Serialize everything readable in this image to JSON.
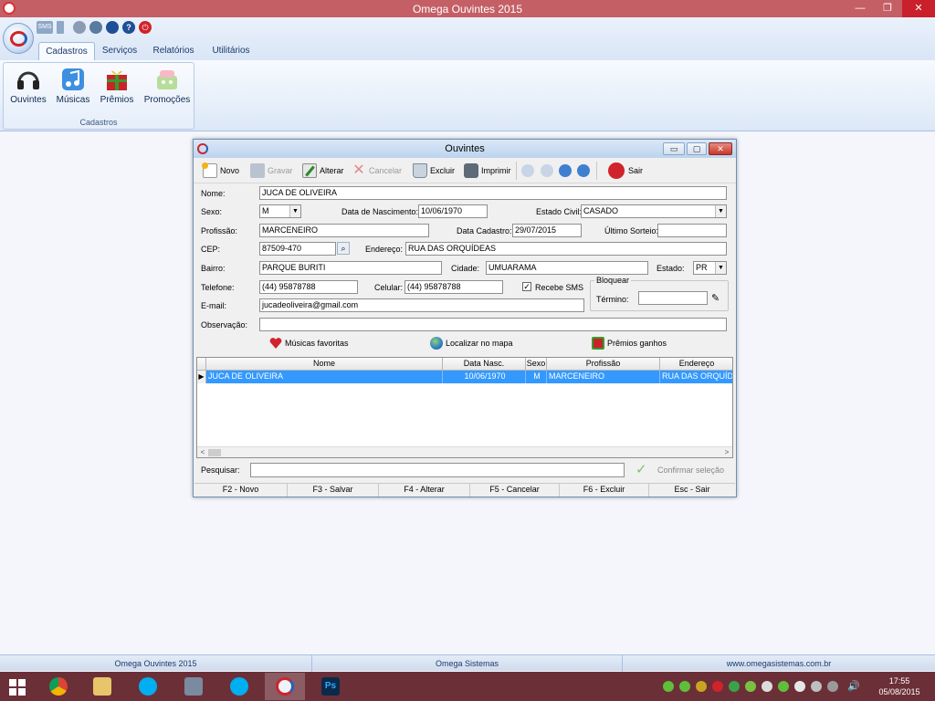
{
  "app": {
    "title": "Omega Ouvintes 2015",
    "window_controls": {
      "minimize": "—",
      "maximize": "❐",
      "close": "✕"
    }
  },
  "ribbon": {
    "tabs": [
      {
        "label": "Cadastros",
        "active": true
      },
      {
        "label": "Serviços",
        "active": false
      },
      {
        "label": "Relatórios",
        "active": false
      },
      {
        "label": "Utilitários",
        "active": false
      }
    ],
    "group_label": "Cadastros",
    "buttons": [
      {
        "label": "Ouvintes",
        "icon": "headphones-icon"
      },
      {
        "label": "Músicas",
        "icon": "music-note-icon"
      },
      {
        "label": "Prêmios",
        "icon": "gift-icon"
      },
      {
        "label": "Promoções",
        "icon": "promotion-icon"
      }
    ],
    "quick_access": {
      "sms": "SMS",
      "help": "?",
      "power": "⏻"
    }
  },
  "dialog": {
    "title": "Ouvintes",
    "controls": {
      "minimize": "▭",
      "maximize": "▢",
      "close": "✕"
    },
    "toolbar": {
      "novo": "Novo",
      "gravar": "Gravar",
      "alterar": "Alterar",
      "cancelar": "Cancelar",
      "excluir": "Excluir",
      "imprimir": "Imprimir",
      "sair": "Sair"
    },
    "form": {
      "nome_label": "Nome:",
      "nome": "JUCA DE OLIVEIRA",
      "sexo_label": "Sexo:",
      "sexo": "M",
      "nascimento_label": "Data de Nascimento:",
      "nascimento": "10/06/1970",
      "estado_civil_label": "Estado Civil:",
      "estado_civil": "CASADO",
      "profissao_label": "Profissão:",
      "profissao": "MARCENEIRO",
      "data_cadastro_label": "Data Cadastro:",
      "data_cadastro": "29/07/2015",
      "ultimo_sorteio_label": "Último Sorteio:",
      "ultimo_sorteio": "",
      "cep_label": "CEP:",
      "cep": "87509-470",
      "endereco_label": "Endereço:",
      "endereco": "RUA DAS ORQUÍDEAS",
      "bairro_label": "Bairro:",
      "bairro": "PARQUE BURITI",
      "cidade_label": "Cidade:",
      "cidade": "UMUARAMA",
      "estado_label": "Estado:",
      "estado": "PR",
      "telefone_label": "Telefone:",
      "telefone": "(44) 95878788",
      "celular_label": "Celular:",
      "celular": "(44) 95878788",
      "recebe_sms_label": "Recebe SMS",
      "recebe_sms_check": "✓",
      "bloquear_label": "Bloquear",
      "termino_label": "Término:",
      "termino": "",
      "email_label": "E-mail:",
      "email": "jucadeoliveira@gmail.com",
      "observacao_label": "Observação:",
      "observacao": ""
    },
    "links": {
      "musicas_favoritas": "Músicas favoritas",
      "localizar_mapa": "Localizar no mapa",
      "premios_ganhos": "Prêmios ganhos"
    },
    "grid": {
      "columns": [
        "Nome",
        "Data Nasc.",
        "Sexo",
        "Profissão",
        "Endereço"
      ],
      "rows": [
        [
          "JUCA DE OLIVEIRA",
          "10/06/1970",
          "M",
          "MARCENEIRO",
          "RUA DAS ORQUÍDE"
        ]
      ],
      "row_indicator": "▶",
      "scroll_left": "<",
      "scroll_right": ">"
    },
    "search": {
      "label": "Pesquisar:",
      "value": "",
      "confirm": "Confirmar seleção"
    },
    "function_keys": [
      "F2 - Novo",
      "F3 - Salvar",
      "F4 - Alterar",
      "F5 - Cancelar",
      "F6 - Excluir",
      "Esc - Sair"
    ]
  },
  "statusbar": {
    "left": "Omega Ouvintes 2015",
    "middle": "Omega Sistemas",
    "right": "www.omegasistemas.com.br"
  },
  "taskbar": {
    "time": "17:55",
    "date": "05/08/2015",
    "ps_label": "Ps"
  },
  "colors": {
    "titlebar": "#c45f66",
    "selection": "#3399ff",
    "taskbar": "#6b2f38",
    "close": "#c9202b"
  }
}
